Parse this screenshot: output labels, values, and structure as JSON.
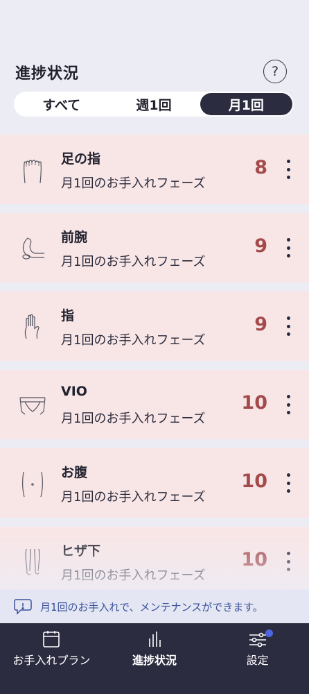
{
  "header": {
    "title": "進捗状況",
    "help_icon": "question-circle-icon"
  },
  "segment": {
    "tabs": [
      "すべて",
      "週1回",
      "月1回"
    ],
    "selected": "月1回"
  },
  "items": [
    {
      "name": "足の指",
      "phase": "月1回のお手入れフェーズ",
      "count": "8",
      "icon": "foot-toes-icon"
    },
    {
      "name": "前腕",
      "phase": "月1回のお手入れフェーズ",
      "count": "9",
      "icon": "forearm-icon"
    },
    {
      "name": "指",
      "phase": "月1回のお手入れフェーズ",
      "count": "9",
      "icon": "hand-fingers-icon"
    },
    {
      "name": "VIO",
      "phase": "月1回のお手入れフェーズ",
      "count": "10",
      "icon": "vio-icon"
    },
    {
      "name": "お腹",
      "phase": "月1回のお手入れフェーズ",
      "count": "10",
      "icon": "belly-icon"
    },
    {
      "name": "ヒザ下",
      "phase": "月1回のお手入れフェーズ",
      "count": "10",
      "icon": "lower-leg-icon"
    }
  ],
  "info": {
    "text": "月1回のお手入れで、メンテナンスができます。",
    "icon": "chat-info-icon"
  },
  "nav": [
    {
      "label": "お手入れプラン",
      "icon": "calendar-icon"
    },
    {
      "label": "進捗状況",
      "icon": "bar-chart-icon"
    },
    {
      "label": "設定",
      "icon": "sliders-icon"
    }
  ],
  "colors": {
    "card_bg": "#f8e6e7",
    "count": "#a54a4a",
    "nav_bg": "#2c2c40",
    "accent_dot": "#4d66e0",
    "info_text": "#3a5299"
  }
}
